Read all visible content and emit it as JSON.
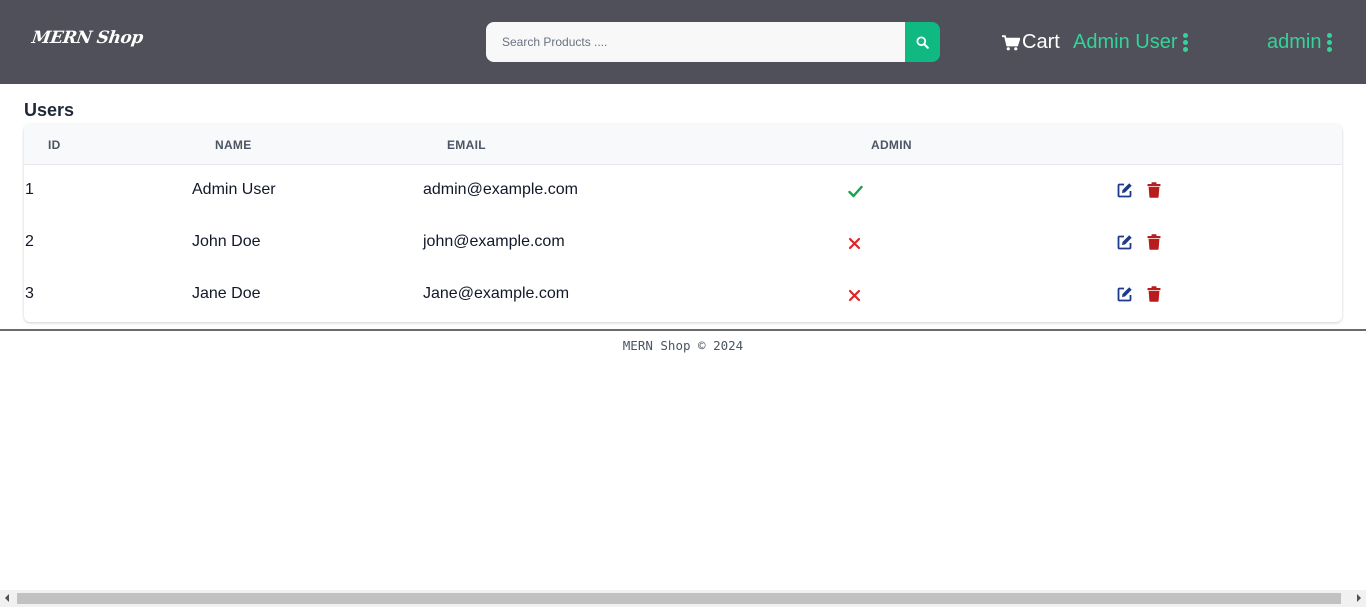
{
  "header": {
    "logo": "MERN Shop",
    "search": {
      "placeholder": "Search Products ....",
      "value": ""
    },
    "cart_label": "Cart",
    "user_menu_label": "Admin User",
    "admin_menu_label": "admin"
  },
  "page": {
    "title": "Users",
    "columns": [
      "ID",
      "NAME",
      "EMAIL",
      "ADMIN"
    ],
    "rows": [
      {
        "id": "1",
        "name": "Admin User",
        "email": "admin@example.com",
        "is_admin": true
      },
      {
        "id": "2",
        "name": "John Doe",
        "email": "john@example.com",
        "is_admin": false
      },
      {
        "id": "3",
        "name": "Jane Doe",
        "email": "Jane@example.com",
        "is_admin": false
      }
    ]
  },
  "footer": {
    "text": "MERN Shop © 2024"
  },
  "colors": {
    "header_bg": "#4f5059",
    "accent_green": "#10b981",
    "admin_link": "#34d399",
    "check": "#16a34a",
    "cross": "#dc2626",
    "edit": "#1e3a8a",
    "delete": "#b91c1c"
  },
  "icons": {
    "search": "search-icon",
    "cart": "cart-icon",
    "menu": "kebab-menu-icon",
    "check": "check-icon",
    "cross": "cross-icon",
    "edit": "edit-icon",
    "delete": "trash-icon"
  }
}
